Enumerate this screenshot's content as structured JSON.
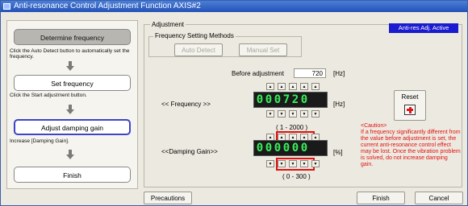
{
  "window": {
    "title": "Anti-resonance Control Adjustment Function AXIS#2"
  },
  "steps": [
    {
      "label": "Determine frequency",
      "desc": "Click the Auto Detect button to automatically set the frequency."
    },
    {
      "label": "Set frequency",
      "desc": "Click the Start adjustment button."
    },
    {
      "label": "Adjust damping gain",
      "desc": "Increase [Damping Gain]."
    },
    {
      "label": "Finish",
      "desc": ""
    }
  ],
  "adjustment": {
    "group_label": "Adjustment",
    "status": "Anti-res Adj. Active",
    "frequency_methods": {
      "label": "Frequency Setting Methods",
      "auto_detect": "Auto Detect",
      "manual_set": "Manual Set"
    },
    "before_label": "Before adjustment",
    "before_value": "720",
    "before_unit": "[Hz]",
    "frequency": {
      "label": "<< Frequency >>",
      "digits": [
        "0",
        "0",
        "0",
        "7",
        "2",
        "0"
      ],
      "unit": "[Hz]",
      "range": "( 1 - 2000 )"
    },
    "damping": {
      "label": "<<Damping Gain>>",
      "digits": [
        "0",
        "0",
        "0",
        "0",
        "0",
        "0"
      ],
      "unit": "[%]",
      "range": "( 0 - 300 )"
    },
    "reset_label": "Reset",
    "caution": "<Caution>\nIf a frequency significantly different from the value before adjustment is set, the current anti-resonance control effect may be lost. Once the vibration problem is solved, do not increase damping gain."
  },
  "buttons": {
    "precautions": "Precautions",
    "finish": "Finish",
    "cancel": "Cancel"
  },
  "colors": {
    "status_bg": "#1b1bd0",
    "digit_color": "#39f05a",
    "caution": "#e01010",
    "highlight": "#e01010"
  }
}
